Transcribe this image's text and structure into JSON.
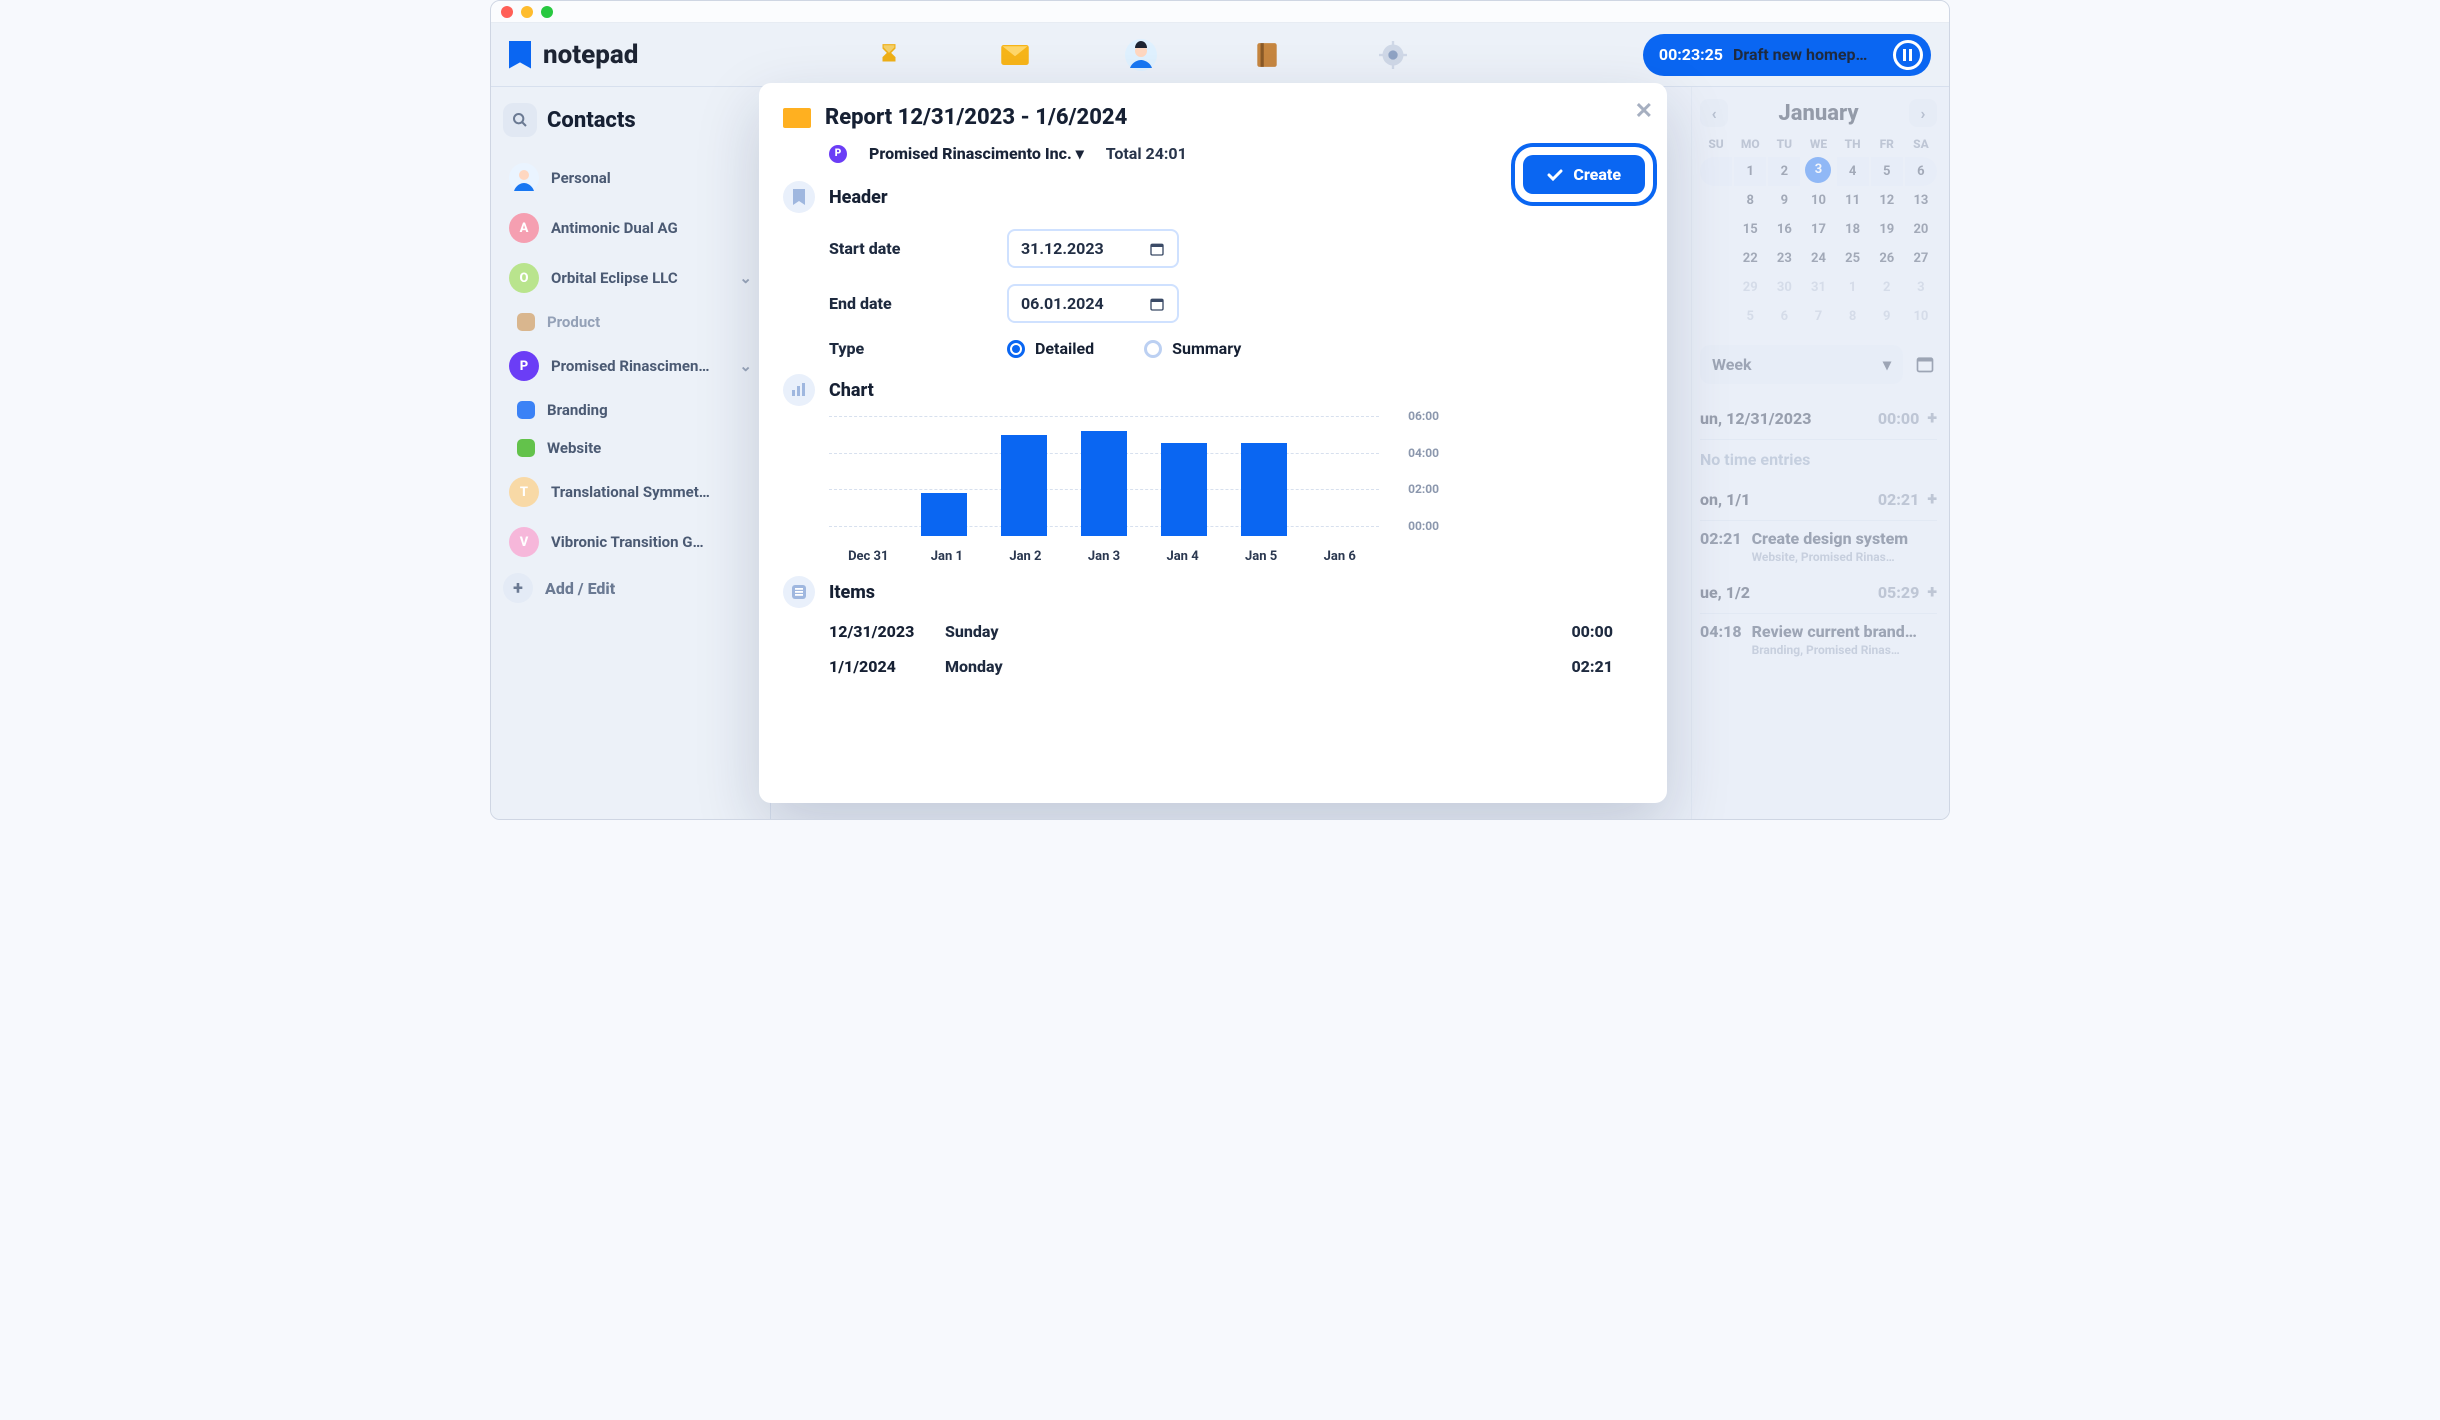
{
  "app": {
    "name": "notepad"
  },
  "timer": {
    "elapsed": "00:23:25",
    "task": "Draft new homep…"
  },
  "sidebar": {
    "title": "Contacts",
    "personal": "Personal",
    "items": [
      {
        "initial": "A",
        "color": "#f59fb1",
        "name": "Antimonic Dual AG"
      },
      {
        "initial": "O",
        "color": "#b9e48d",
        "name": "Orbital Eclipse LLC"
      },
      {
        "initial": "P",
        "color": "#6b3df6",
        "name": "Promised Rinascimen…",
        "expanded": true
      },
      {
        "initial": "T",
        "color": "#f8d9a6",
        "name": "Translational Symmet…"
      },
      {
        "initial": "V",
        "color": "#f6b7da",
        "name": "Vibronic Transition G…"
      }
    ],
    "product_label": "Product",
    "p_children": [
      {
        "color": "#3b82f6",
        "name": "Branding"
      },
      {
        "color": "#63c24b",
        "name": "Website"
      }
    ],
    "add_edit": "Add / Edit"
  },
  "calendar": {
    "month": "January",
    "dow": [
      "SU",
      "MO",
      "TU",
      "WE",
      "TH",
      "FR",
      "SA"
    ],
    "rows": [
      [
        "",
        "1",
        "2",
        "3",
        "4",
        "5",
        "6"
      ],
      [
        "",
        "8",
        "9",
        "10",
        "11",
        "12",
        "13"
      ],
      [
        "",
        "15",
        "16",
        "17",
        "18",
        "19",
        "20"
      ],
      [
        "",
        "22",
        "23",
        "24",
        "25",
        "26",
        "27"
      ],
      [
        "",
        "29",
        "30",
        "31",
        "1",
        "2",
        "3"
      ],
      [
        "",
        "5",
        "6",
        "7",
        "8",
        "9",
        "10"
      ]
    ],
    "selected": "3",
    "week_select": "Week"
  },
  "entries": {
    "days": [
      {
        "label": "un, 12/31/2023",
        "time": "00:00",
        "empty": "No time entries"
      },
      {
        "label": "on, 1/1",
        "time": "02:21",
        "task": {
          "dur": "02:21",
          "title": "Create design system",
          "sub": "Website, Promised Rinas…"
        }
      },
      {
        "label": "ue, 1/2",
        "time": "05:29",
        "task": {
          "dur": "04:18",
          "title": "Review current brand…",
          "sub": "Branding, Promised Rinas…"
        }
      }
    ]
  },
  "modal": {
    "title": "Report 12/31/2023 - 1/6/2024",
    "client": "Promised Rinascimento Inc.",
    "total": "Total 24:01",
    "header_label": "Header",
    "start_date_label": "Start date",
    "start_date": "31.12.2023",
    "end_date_label": "End date",
    "end_date": "06.01.2024",
    "type_label": "Type",
    "type_detailed": "Detailed",
    "type_summary": "Summary",
    "create": "Create",
    "chart_label": "Chart",
    "items_label": "Items",
    "items": [
      {
        "date": "12/31/2023",
        "day": "Sunday",
        "dur": "00:00"
      },
      {
        "date": "1/1/2024",
        "day": "Monday",
        "dur": "02:21"
      }
    ]
  },
  "chart_data": {
    "type": "bar",
    "title": "",
    "xlabel": "",
    "ylabel": "",
    "ylim": [
      0,
      6
    ],
    "y_ticks": [
      "06:00",
      "04:00",
      "02:00",
      "00:00"
    ],
    "categories": [
      "Dec 31",
      "Jan 1",
      "Jan 2",
      "Jan 3",
      "Jan 4",
      "Jan 5",
      "Jan 6"
    ],
    "values": [
      0,
      2.35,
      5.5,
      5.75,
      5.1,
      5.1,
      0
    ]
  }
}
